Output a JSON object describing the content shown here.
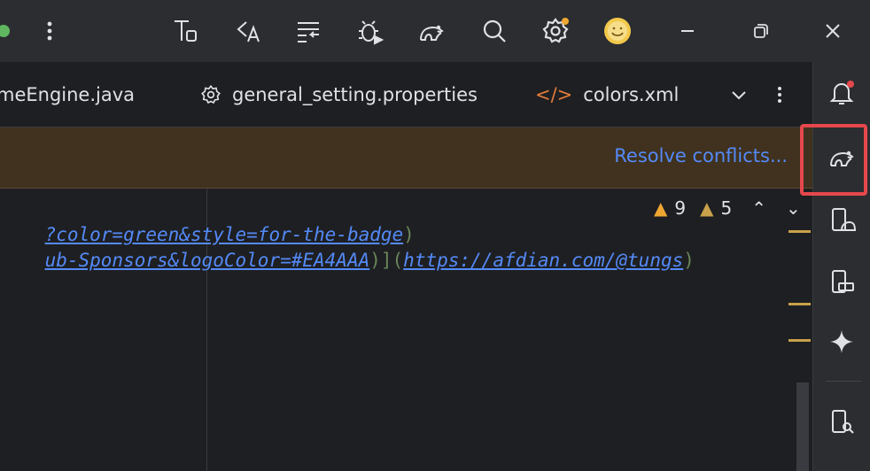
{
  "toolbar": {
    "icons": [
      "project-structure-icon",
      "translate-icon",
      "format-icon",
      "debug-icon",
      "gradle-icon",
      "search-icon",
      "settings-icon",
      "avatar"
    ],
    "window": {
      "minimize": "—",
      "restore": "❐",
      "close": "✕"
    }
  },
  "tabs": [
    {
      "label": "meEngine.java"
    },
    {
      "label": "general_setting.properties"
    },
    {
      "label": "colors.xml"
    }
  ],
  "banner": {
    "link": "Resolve conflicts..."
  },
  "inspections": {
    "warnings": "9",
    "weak_warnings": "5"
  },
  "code": {
    "line1": "?color=green&style=for-the-badge",
    "line2_a": "ub-Sponsors&logoColor=#EA4AAA",
    "line2_b": "https://afdian.com/@tungs",
    "paren_close": ")",
    "bracket_paren": ")](",
    "paren_end": ")"
  },
  "colors": {
    "accent": "#548af7",
    "banner_bg": "#40321f",
    "highlight": "#e5484d"
  }
}
